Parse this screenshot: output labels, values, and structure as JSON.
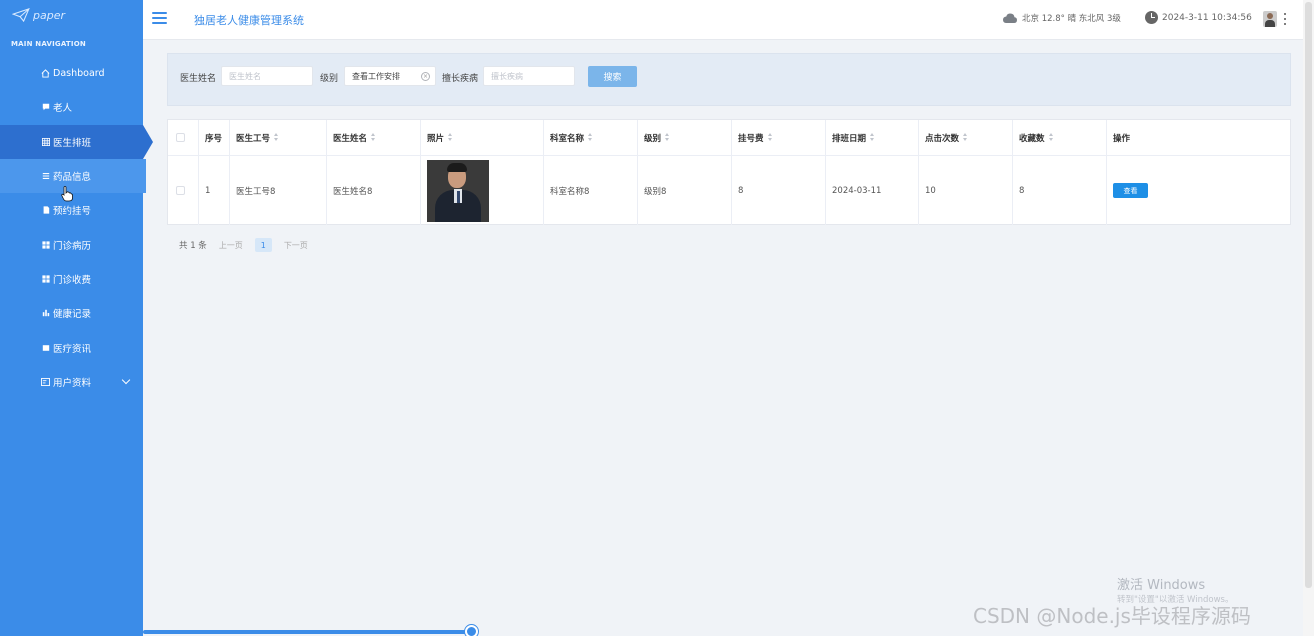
{
  "sidebar": {
    "logo_text": "paper",
    "nav_heading": "MAIN NAVIGATION",
    "items": [
      {
        "label": "Dashboard",
        "icon": "home-icon"
      },
      {
        "label": "老人",
        "icon": "comment-icon"
      },
      {
        "label": "医生排班",
        "icon": "grid-icon",
        "active": true
      },
      {
        "label": "药品信息",
        "icon": "list-icon"
      },
      {
        "label": "预约挂号",
        "icon": "file-icon"
      },
      {
        "label": "门诊病历",
        "icon": "apps-icon"
      },
      {
        "label": "门诊收费",
        "icon": "apps-icon"
      },
      {
        "label": "健康记录",
        "icon": "bar-chart-icon"
      },
      {
        "label": "医疗资讯",
        "icon": "square-icon"
      },
      {
        "label": "用户资料",
        "icon": "id-card-icon",
        "expandable": true
      }
    ]
  },
  "header": {
    "title": "独居老人健康管理系统",
    "weather": "北京 12.8° 晴 东北风 3级",
    "datetime": "2024-3-11 10:34:56"
  },
  "search": {
    "doctor_name_label": "医生姓名",
    "doctor_name_placeholder": "医生姓名",
    "level_label": "级别",
    "level_value": "查看工作安排",
    "specialty_label": "擅长疾病",
    "specialty_placeholder": "擅长疾病",
    "search_button": "搜索"
  },
  "table": {
    "columns": [
      "序号",
      "医生工号",
      "医生姓名",
      "照片",
      "科室名称",
      "级别",
      "挂号费",
      "排班日期",
      "点击次数",
      "收藏数",
      "操作"
    ],
    "rows": [
      {
        "index": "1",
        "doctor_id": "医生工号8",
        "doctor_name": "医生姓名8",
        "department": "科室名称8",
        "level": "级别8",
        "fee": "8",
        "date": "2024-03-11",
        "clicks": "10",
        "favorites": "8",
        "action": "查看"
      }
    ]
  },
  "pagination": {
    "total": "共 1 条",
    "prev": "上一页",
    "current": "1",
    "next": "下一页"
  },
  "watermark": {
    "activate_title": "激活 Windows",
    "activate_sub": "转到\"设置\"以激活 Windows。",
    "csdn": "CSDN @Node.js毕设程序源码"
  },
  "colors": {
    "sidebar": "#3b8ce8",
    "accent": "#3b8ce8",
    "button": "#1e8fe6"
  }
}
